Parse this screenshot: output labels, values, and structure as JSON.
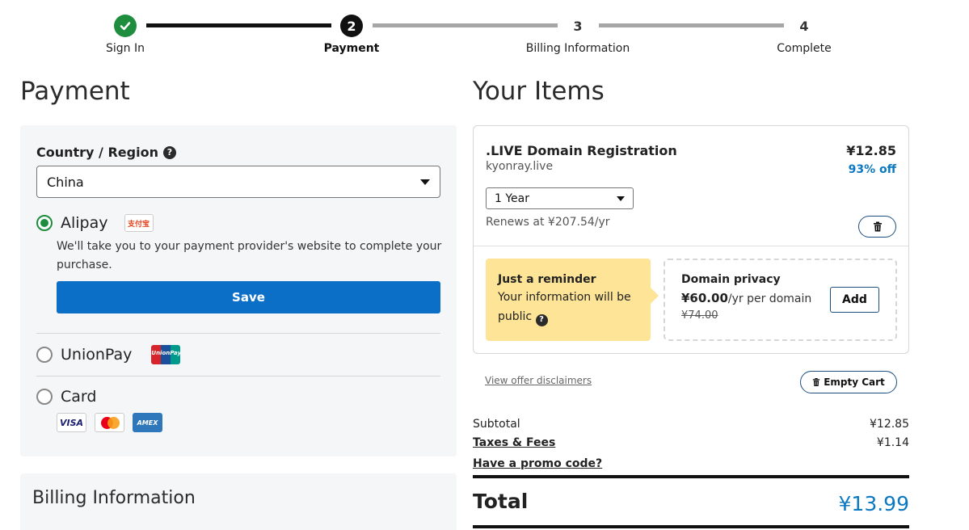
{
  "stepper": {
    "steps": [
      {
        "number": "",
        "label": "Sign In",
        "state": "done"
      },
      {
        "number": "2",
        "label": "Payment",
        "state": "active"
      },
      {
        "number": "3",
        "label": "Billing Information",
        "state": "todo"
      },
      {
        "number": "4",
        "label": "Complete",
        "state": "todo"
      }
    ]
  },
  "payment": {
    "title": "Payment",
    "country_label": "Country / Region",
    "country_value": "China",
    "alipay_label": "Alipay",
    "alipay_logo_text": "支付宝",
    "alipay_description": "We'll take you to your payment provider's website to complete your purchase.",
    "save_label": "Save",
    "unionpay_label": "UnionPay",
    "unionpay_logo_text": "UnionPay",
    "card_label": "Card",
    "card_logos": {
      "visa": "VISA",
      "amex": "AMEX"
    },
    "selected_method": "alipay"
  },
  "billing": {
    "title": "Billing Information"
  },
  "items": {
    "title": "Your Items",
    "product_name": ".LIVE Domain Registration",
    "domain": "kyonray.live",
    "price": "¥12.85",
    "discount": "93% off",
    "term": "1 Year",
    "renews": "Renews at ¥207.54/yr",
    "reminder_title": "Just a reminder",
    "reminder_text": "Your information will be public",
    "privacy_title": "Domain privacy",
    "privacy_price": "¥60.00",
    "privacy_price_suffix": "/yr per domain",
    "privacy_old_price": "¥74.00",
    "add_label": "Add"
  },
  "cart": {
    "disclaimers": "View offer disclaimers",
    "empty_cart": "Empty Cart",
    "subtotal_label": "Subtotal",
    "subtotal_value": "¥12.85",
    "taxes_label": "Taxes & Fees",
    "taxes_value": "¥1.14",
    "promo_label": "Have a promo code?",
    "total_label": "Total",
    "total_value": "¥13.99"
  },
  "colors": {
    "accent_blue": "#0b6fc7",
    "success_green": "#1e8e3e",
    "reminder_yellow": "#fde497",
    "price_blue": "#0b79c1"
  }
}
